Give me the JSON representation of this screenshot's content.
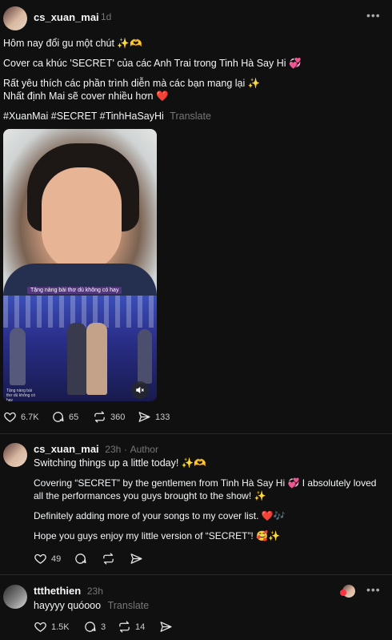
{
  "post": {
    "username": "cs_xuan_mai",
    "time": "1d",
    "lines": [
      "Hôm nay đổi gu một chút ✨🫶",
      "Cover ca khúc 'SECRET' của các Anh Trai trong Tinh Hà Say Hi 💞",
      "Rất yêu thích các phần trình diễn mà các bạn mang lại ✨",
      "Nhất định Mai sẽ cover nhiều hơn ❤️"
    ],
    "hashtags": "#XuanMai #SECRET #TinhHaSayHi",
    "translate": "Translate",
    "video_caption": "Tặng nàng bài thơ dù không có hay",
    "video_small_caption": "Tặng nàng bài thơ dù không có hay",
    "likes": "6.7K",
    "comments": "65",
    "reposts": "360",
    "shares": "133"
  },
  "reply1": {
    "username": "cs_xuan_mai",
    "time": "23h",
    "separator": "·",
    "badge": "Author",
    "lines": [
      "Switching things up a little today! ✨🫶",
      "Covering “SECRET” by the gentlemen from Tinh Hà Say Hi 💞 I absolutely loved",
      "all the performances you guys brought to the show! ✨",
      "Definitely adding more of your songs to my cover list. ❤️🎶",
      "Hope you guys enjoy my little version of “SECRET”! 🥰✨"
    ],
    "likes": "49"
  },
  "reply2": {
    "username": "ttthethien",
    "time": "23h",
    "text": "hayyyy quóooo",
    "translate": "Translate",
    "likes": "1.5K",
    "comments": "3",
    "reposts": "14"
  },
  "more_icon": "•••"
}
